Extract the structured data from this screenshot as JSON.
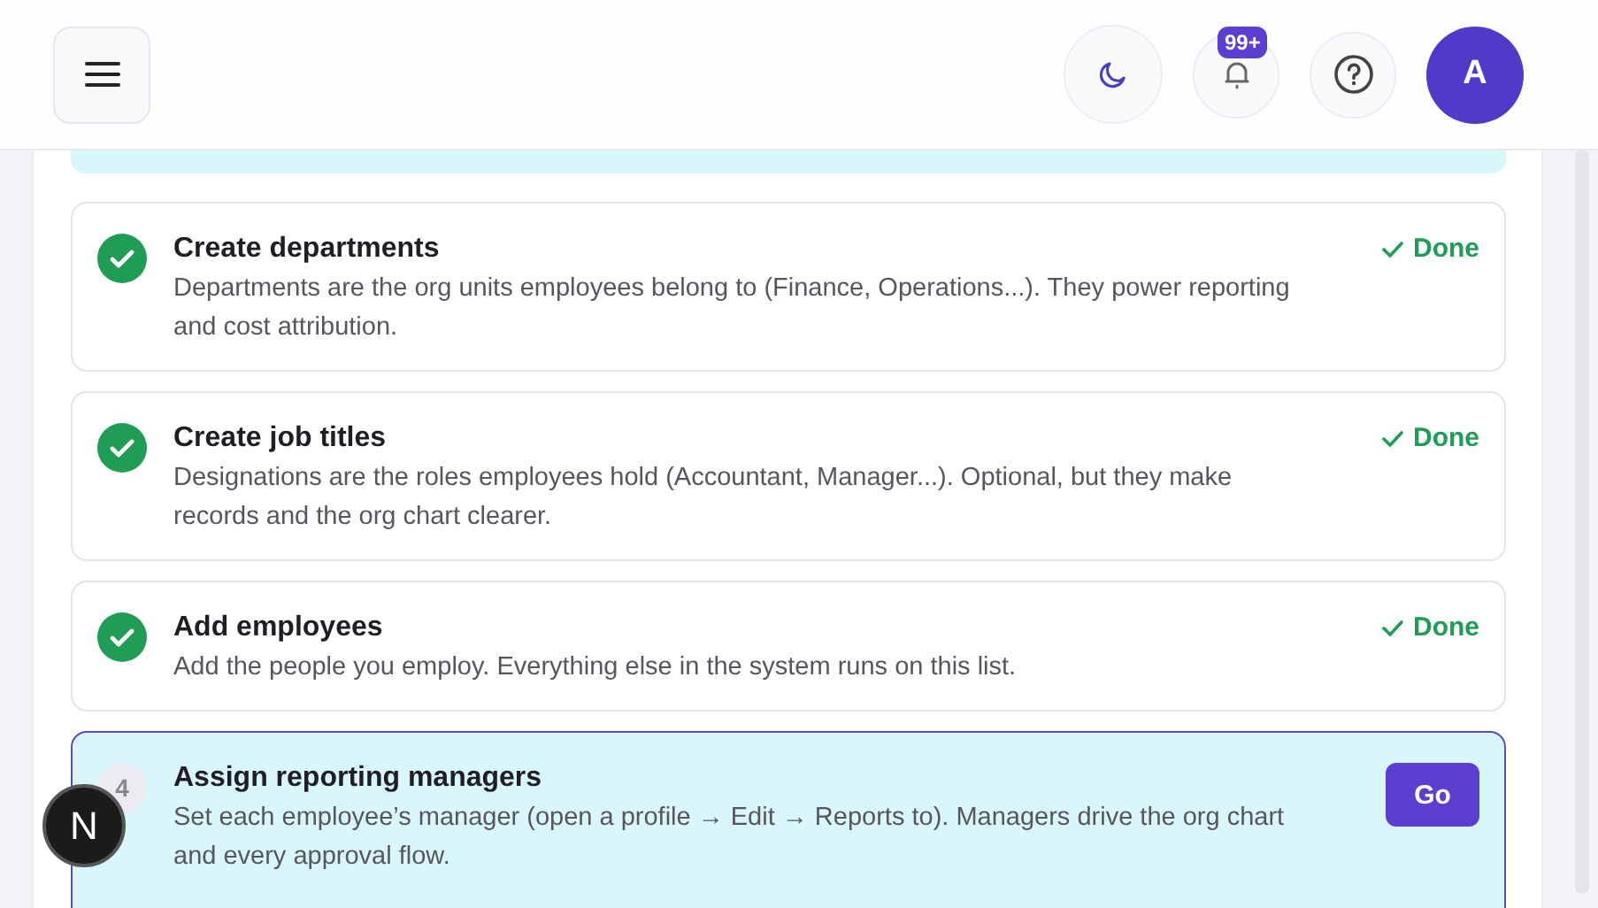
{
  "header": {
    "notifications": {
      "badge": "99+"
    },
    "avatar": {
      "initial": "A"
    }
  },
  "steps": [
    {
      "kind": "done",
      "title": "Create departments",
      "description": "Departments are the org units employees belong to (Finance, Operations...). They power reporting and cost attribution.",
      "status": "Done"
    },
    {
      "kind": "done",
      "title": "Create job titles",
      "description": "Designations are the roles employees hold (Accountant, Manager...). Optional, but they make records and the org chart clearer.",
      "status": "Done"
    },
    {
      "kind": "done",
      "title": "Add employees",
      "description": "Add the people you employ. Everything else in the system runs on this list.",
      "status": "Done"
    },
    {
      "kind": "current",
      "number": "4",
      "title": "Assign reporting managers",
      "description": "Set each employee’s manager (open a profile → Edit → Reports to). Managers drive the org chart and every approval flow.",
      "action": "Go"
    }
  ],
  "floating_badge": {
    "letter": "N"
  }
}
